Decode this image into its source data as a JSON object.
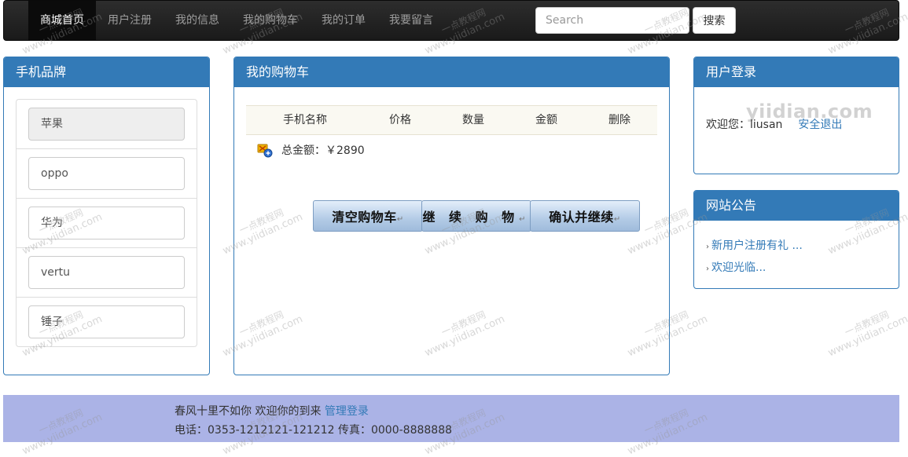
{
  "navbar": {
    "items": [
      {
        "label": "商城首页",
        "active": true
      },
      {
        "label": "用户注册",
        "active": false
      },
      {
        "label": "我的信息",
        "active": false
      },
      {
        "label": "我的购物车",
        "active": false
      },
      {
        "label": "我的订单",
        "active": false
      },
      {
        "label": "我要留言",
        "active": false
      }
    ],
    "search_placeholder": "Search",
    "search_button": "搜索"
  },
  "brands": {
    "title": "手机品牌",
    "items": [
      "苹果",
      "oppo",
      "华为",
      "vertu",
      "锤子"
    ],
    "selected": "苹果"
  },
  "cart": {
    "title": "我的购物车",
    "columns": [
      "手机名称",
      "价格",
      "数量",
      "金额",
      "删除"
    ],
    "total_label": "总金额：￥2890",
    "total_icon": "cart-total-icon",
    "buttons": [
      "清空购物车",
      "继 续 购 物",
      "确认并继续"
    ],
    "button_mark": "↵"
  },
  "login": {
    "title": "用户登录",
    "welcome": "欢迎您：liusan",
    "logout": "安全退出",
    "logo_text": "yiidian.com"
  },
  "notices": {
    "title": "网站公告",
    "items": [
      "新用户注册有礼 ...",
      "欢迎光临..."
    ]
  },
  "footer": {
    "line1": "春风十里不如你 欢迎你的到来",
    "admin_link": "管理登录",
    "line2": "电话：0353-1212121-121212 传真：0000-8888888"
  },
  "watermark": {
    "cn": "一点教程网",
    "url": "www.yiidian.com"
  },
  "colors": {
    "primary": "#337ab7",
    "navbar": "#222222",
    "footer": "#abb3e6"
  }
}
